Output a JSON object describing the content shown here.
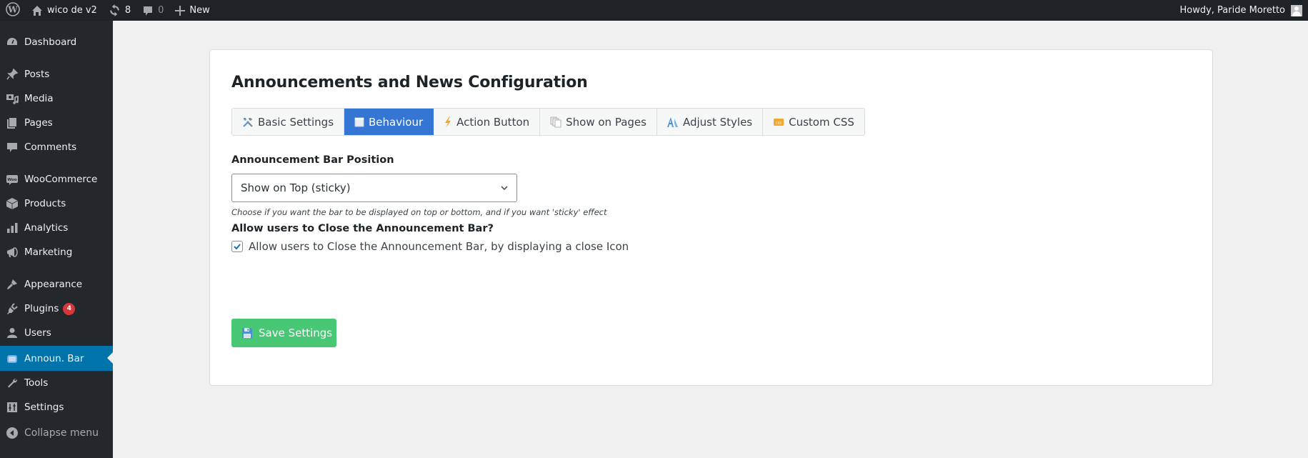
{
  "admin_bar": {
    "site_name": "wico de v2",
    "updates_count": "8",
    "comments_count": "0",
    "new_label": "New",
    "greeting": "Howdy, Paride Moretto"
  },
  "sidebar": {
    "items": [
      {
        "label": "Dashboard",
        "icon": "dashboard-icon"
      },
      {
        "label": "Posts",
        "icon": "pin-icon"
      },
      {
        "label": "Media",
        "icon": "media-icon"
      },
      {
        "label": "Pages",
        "icon": "pages-icon"
      },
      {
        "label": "Comments",
        "icon": "comment-icon"
      },
      {
        "label": "WooCommerce",
        "icon": "woo-icon"
      },
      {
        "label": "Products",
        "icon": "box-icon"
      },
      {
        "label": "Analytics",
        "icon": "bar-chart-icon"
      },
      {
        "label": "Marketing",
        "icon": "megaphone-icon"
      },
      {
        "label": "Appearance",
        "icon": "paintbrush-icon"
      },
      {
        "label": "Plugins",
        "icon": "plug-icon",
        "badge": "4"
      },
      {
        "label": "Users",
        "icon": "user-icon"
      },
      {
        "label": "Announ. Bar",
        "icon": "announcement-icon",
        "active": true
      },
      {
        "label": "Tools",
        "icon": "wrench-icon"
      },
      {
        "label": "Settings",
        "icon": "sliders-icon"
      }
    ],
    "collapse_label": "Collapse menu"
  },
  "page": {
    "title": "Announcements and News Configuration",
    "tabs": [
      {
        "label": "Basic Settings",
        "icon": "tools-icon"
      },
      {
        "label": "Behaviour",
        "icon": "window-icon",
        "active": true
      },
      {
        "label": "Action Button",
        "icon": "lightning-icon"
      },
      {
        "label": "Show on Pages",
        "icon": "copy-pages-icon"
      },
      {
        "label": "Adjust Styles",
        "icon": "styles-icon"
      },
      {
        "label": "Custom CSS",
        "icon": "css-icon"
      }
    ],
    "position_label": "Announcement Bar Position",
    "position_value": "Show on Top (sticky)",
    "position_hint": "Choose if you want the bar to be displayed on top or bottom, and if you want 'sticky' effect",
    "close_label": "Allow users to Close the Announcement Bar?",
    "close_checkbox_label": "Allow users to Close the Announcement Bar, by displaying a close Icon",
    "close_checked": true,
    "save_label": "Save Settings"
  },
  "colors": {
    "adminbar_bg": "#1d2327",
    "sidebar_bg": "#23282d",
    "sidebar_active": "#0073aa",
    "tab_active": "#3575d3",
    "save_button": "#48c774",
    "badge": "#d63638"
  }
}
